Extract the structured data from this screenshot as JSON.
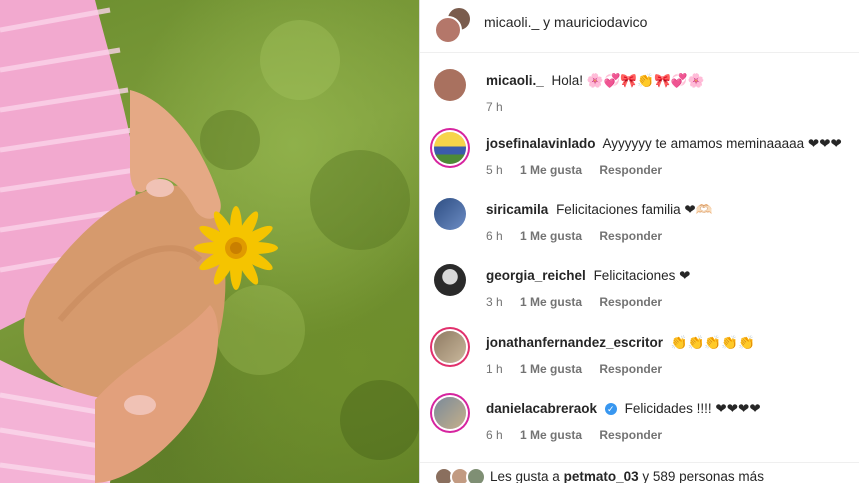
{
  "post": {
    "authors": "micaoli._ y mauriciodavico"
  },
  "comments": [
    {
      "user": "micaoli._",
      "text": "Hola! 🌸💞🎀👏🎀💞🌸",
      "time": "7 h",
      "likes": "",
      "reply": ""
    },
    {
      "user": "josefinalavinlado",
      "text": "Ayyyyyy te amamos meminaaaaa ❤❤❤",
      "time": "5 h",
      "likes": "1 Me gusta",
      "reply": "Responder"
    },
    {
      "user": "siricamila",
      "text": "Felicitaciones familia ❤🫶🏻",
      "time": "6 h",
      "likes": "1 Me gusta",
      "reply": "Responder"
    },
    {
      "user": "georgia_reichel",
      "text": "Felicitaciones ❤",
      "time": "3 h",
      "likes": "1 Me gusta",
      "reply": "Responder"
    },
    {
      "user": "jonathanfernandez_escritor",
      "text": "👏👏👏👏👏",
      "time": "1 h",
      "likes": "1 Me gusta",
      "reply": "Responder"
    },
    {
      "user": "danielacabreraok",
      "text": "Felicidades !!!! ❤❤❤❤",
      "time": "6 h",
      "likes": "1 Me gusta",
      "reply": "Responder",
      "verified": true
    }
  ],
  "footer": {
    "prefix": "Les gusta a",
    "user": "petmato_03",
    "suffix": "y 589 personas más"
  },
  "colors": {
    "heart": "#e0245e",
    "verified": "#3897f0",
    "ring": "#d6249f"
  }
}
